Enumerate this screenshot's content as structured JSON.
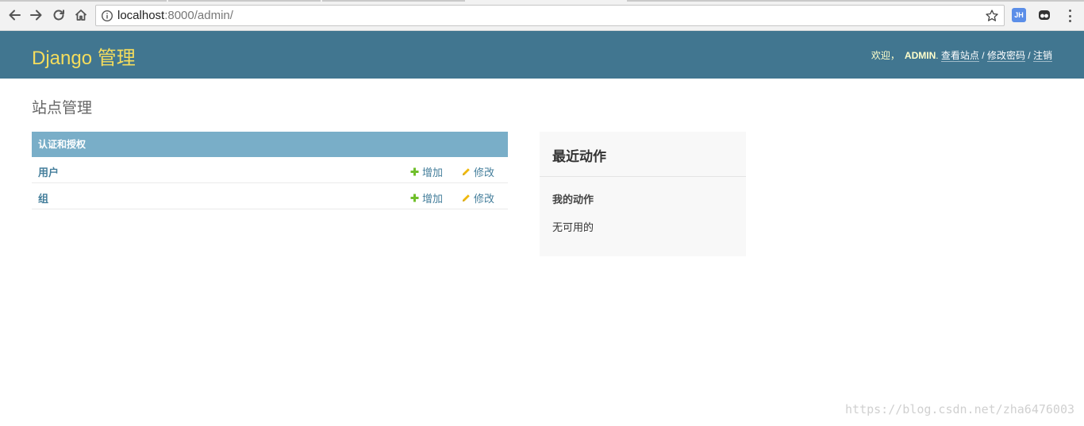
{
  "browser": {
    "url_host": "localhost",
    "url_rest": ":8000/admin/",
    "extension_jh": "JH"
  },
  "header": {
    "branding": "Django 管理",
    "welcome": "欢迎，",
    "username": "ADMIN",
    "username_suffix": ".",
    "view_site": "查看站点",
    "change_password": "修改密码",
    "logout": "注销",
    "separator": " / "
  },
  "content": {
    "title": "站点管理",
    "module": {
      "caption": "认证和授权",
      "rows": [
        {
          "name": "用户",
          "add": "增加",
          "change": "修改"
        },
        {
          "name": "组",
          "add": "增加",
          "change": "修改"
        }
      ]
    },
    "recent": {
      "title": "最近动作",
      "subtitle": "我的动作",
      "empty": "无可用的"
    }
  },
  "watermark": "https://blog.csdn.net/zha6476003",
  "colors": {
    "header_bg": "#417690",
    "branding": "#f5dd5d",
    "module_caption_bg": "#79aec8",
    "link": "#447e9b",
    "add_icon": "#70bf2b",
    "change_icon": "#efb80b"
  }
}
